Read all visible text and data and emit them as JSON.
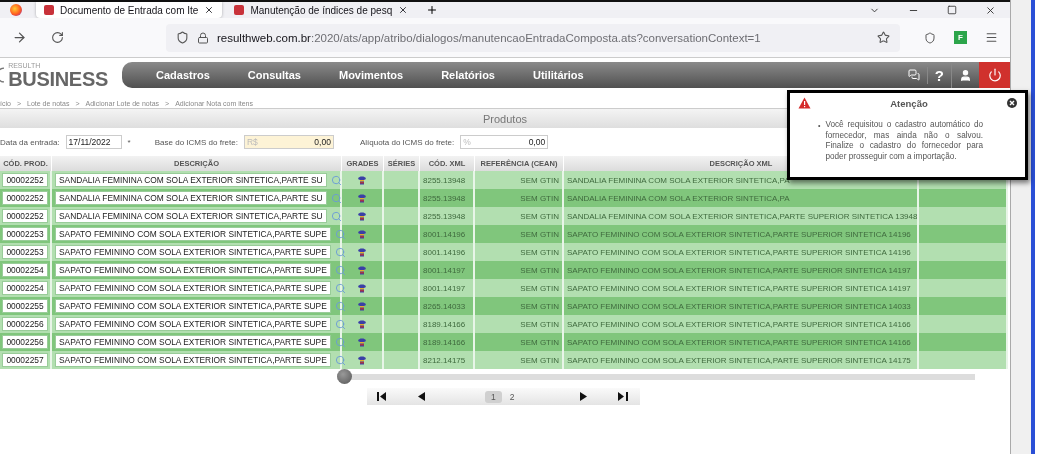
{
  "browser": {
    "tabs": [
      {
        "title": "Documento de Entrada com Ite",
        "selected": true
      },
      {
        "title": "Manutenção de índices de pesq",
        "selected": false
      }
    ],
    "address": {
      "host": "resulthweb.com.br",
      "rest": ":2020/ats/app/atribo/dialogos/manutencaoEntradaComposta.ats?conversationContext=1"
    },
    "extension_badge": "F"
  },
  "app": {
    "logo_small": "RESULTH",
    "logo_big": "BUSINESS",
    "menu": [
      "Cadastros",
      "Consultas",
      "Movimentos",
      "Relatórios",
      "Utilitários"
    ],
    "help": "?"
  },
  "breadcrumb": {
    "separator": ">",
    "items": [
      "ício",
      "Lote de notas",
      "Adicionar Lote de notas",
      "Adicionar Nota com itens"
    ]
  },
  "panel_title": "Produtos",
  "form": [
    {
      "label": "Data da entrada:",
      "value": "17/11/2022",
      "required_mark": "*",
      "focused": false
    },
    {
      "label": "Base do ICMS do frete:",
      "prefix": "R$",
      "value": "0,00",
      "focused": true
    },
    {
      "label": "Alíquota do ICMS do frete:",
      "prefix": "%",
      "value": "0,00",
      "focused": false
    }
  ],
  "table": {
    "columns": [
      "CÓD. PROD.",
      "DESCRIÇÃO",
      "GRADES",
      "SÉRIES",
      "CÓD. XML",
      "REFERÊNCIA (CEAN)",
      "DESCRIÇÃO XML"
    ],
    "rows": [
      {
        "cod_prod": "00002252",
        "descricao": "SANDALIA FEMININA COM SOLA EXTERIOR SINTETICA,PARTE SU",
        "cod_xml": "8255.13948",
        "referencia": "SEM GTIN",
        "descricao_xml": "SANDALIA FEMININA COM SOLA EXTERIOR SINTETICA,PA"
      },
      {
        "cod_prod": "00002252",
        "descricao": "SANDALIA FEMININA COM SOLA EXTERIOR SINTETICA,PARTE SU",
        "cod_xml": "8255.13948",
        "referencia": "SEM GTIN",
        "descricao_xml": "SANDALIA FEMININA COM SOLA EXTERIOR SINTETICA,PA"
      },
      {
        "cod_prod": "00002252",
        "descricao": "SANDALIA FEMININA COM SOLA EXTERIOR SINTETICA,PARTE SU",
        "cod_xml": "8255.13948",
        "referencia": "SEM GTIN",
        "descricao_xml": "SANDALIA FEMININA COM SOLA EXTERIOR SINTETICA,PARTE SUPERIOR SINTETICA 13948"
      },
      {
        "cod_prod": "00002253",
        "descricao": "SAPATO FEMININO COM SOLA EXTERIOR SINTETICA,PARTE SUPE",
        "cod_xml": "8001.14196",
        "referencia": "SEM GTIN",
        "descricao_xml": "SAPATO FEMININO COM SOLA EXTERIOR SINTETICA,PARTE SUPERIOR SINTETICA 14196"
      },
      {
        "cod_prod": "00002253",
        "descricao": "SAPATO FEMININO COM SOLA EXTERIOR SINTETICA,PARTE SUPE",
        "cod_xml": "8001.14196",
        "referencia": "SEM GTIN",
        "descricao_xml": "SAPATO FEMININO COM SOLA EXTERIOR SINTETICA,PARTE SUPERIOR SINTETICA 14196"
      },
      {
        "cod_prod": "00002254",
        "descricao": "SAPATO FEMININO COM SOLA EXTERIOR SINTETICA,PARTE SUPE",
        "cod_xml": "8001.14197",
        "referencia": "SEM GTIN",
        "descricao_xml": "SAPATO FEMININO COM SOLA EXTERIOR SINTETICA,PARTE SUPERIOR SINTETICA 14197"
      },
      {
        "cod_prod": "00002254",
        "descricao": "SAPATO FEMININO COM SOLA EXTERIOR SINTETICA,PARTE SUPE",
        "cod_xml": "8001.14197",
        "referencia": "SEM GTIN",
        "descricao_xml": "SAPATO FEMININO COM SOLA EXTERIOR SINTETICA,PARTE SUPERIOR SINTETICA 14197"
      },
      {
        "cod_prod": "00002255",
        "descricao": "SAPATO FEMININO COM SOLA EXTERIOR SINTETICA,PARTE SUPE",
        "cod_xml": "8265.14033",
        "referencia": "SEM GTIN",
        "descricao_xml": "SAPATO FEMININO COM SOLA EXTERIOR SINTETICA,PARTE SUPERIOR SINTETICA 14033"
      },
      {
        "cod_prod": "00002256",
        "descricao": "SAPATO FEMININO COM SOLA EXTERIOR SINTETICA,PARTE SUPE",
        "cod_xml": "8189.14166",
        "referencia": "SEM GTIN",
        "descricao_xml": "SAPATO FEMININO COM SOLA EXTERIOR SINTETICA,PARTE SUPERIOR SINTETICA 14166"
      },
      {
        "cod_prod": "00002256",
        "descricao": "SAPATO FEMININO COM SOLA EXTERIOR SINTETICA,PARTE SUPE",
        "cod_xml": "8189.14166",
        "referencia": "SEM GTIN",
        "descricao_xml": "SAPATO FEMININO COM SOLA EXTERIOR SINTETICA,PARTE SUPERIOR SINTETICA 14166"
      },
      {
        "cod_prod": "00002257",
        "descricao": "SAPATO FEMININO COM SOLA EXTERIOR SINTETICA,PARTE SUPE",
        "cod_xml": "8212.14175",
        "referencia": "SEM GTIN",
        "descricao_xml": "SAPATO FEMININO COM SOLA EXTERIOR SINTETICA,PARTE SUPERIOR SINTETICA 14175"
      }
    ]
  },
  "pagination": [
    {
      "label": "1",
      "selected": true
    },
    {
      "label": "2",
      "selected": false
    }
  ],
  "dialog": {
    "title": "Atenção",
    "bullet": "•",
    "messages": [
      "Você requisitou o cadastro automático do fornecedor, mas ainda não o salvou. Finalize o cadastro do fornecedor para poder prosseguir com a importação."
    ]
  }
}
